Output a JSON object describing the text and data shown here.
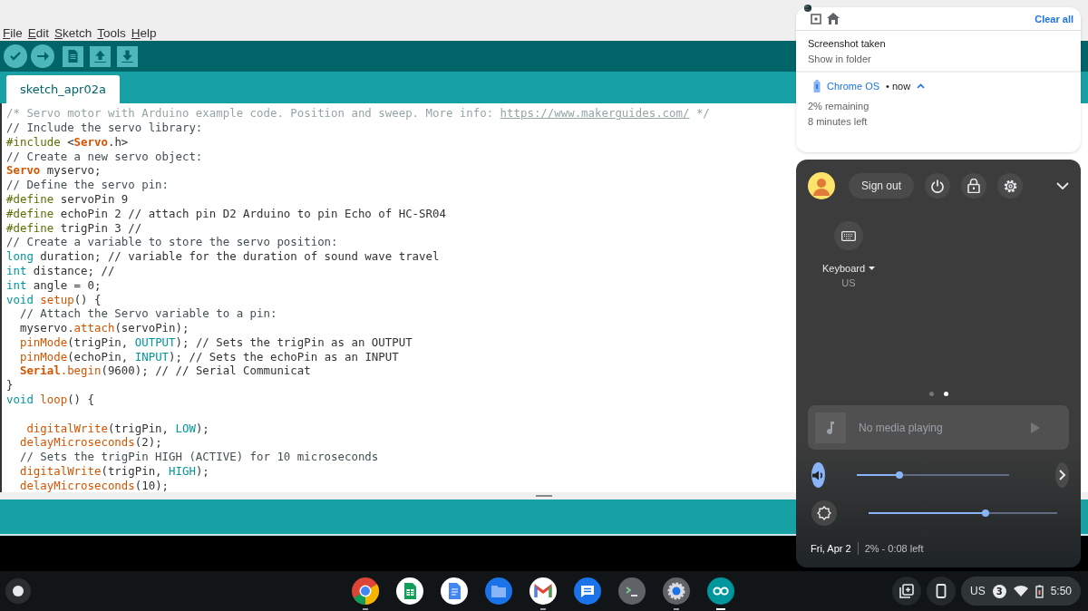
{
  "menu": [
    "File",
    "Edit",
    "Sketch",
    "Tools",
    "Help"
  ],
  "toolbar": [
    {
      "kind": "verify"
    },
    {
      "kind": "upload"
    },
    {
      "kind": "new"
    },
    {
      "kind": "open"
    },
    {
      "kind": "save"
    }
  ],
  "tabs": [
    {
      "label": "sketch_apr02a",
      "selected": true
    }
  ],
  "code": [
    {
      "kind": "code",
      "tokens": [
        {
          "text": "/* Servo motor with Arduino example code. Position and sweep. More info: ",
          "kind": "block"
        },
        {
          "text": "https://www.makerguides.com/",
          "kind": "link"
        },
        {
          "text": " */",
          "kind": "block"
        }
      ]
    },
    {
      "kind": "code",
      "tokens": [
        {
          "text": "// Include the servo library:",
          "kind": "comment"
        }
      ]
    },
    {
      "kind": "code",
      "tokens": [
        {
          "text": "#include",
          "kind": "pre"
        },
        {
          "text": " <",
          "kind": "plain"
        },
        {
          "text": "Servo",
          "kind": "class"
        },
        {
          "text": ".h>",
          "kind": "plain"
        }
      ]
    },
    {
      "kind": "code",
      "tokens": [
        {
          "text": "// Create a new servo object:",
          "kind": "comment"
        }
      ]
    },
    {
      "kind": "code",
      "tokens": [
        {
          "text": "Servo",
          "kind": "class"
        },
        {
          "text": " myservo;",
          "kind": "plain"
        }
      ]
    },
    {
      "kind": "code",
      "tokens": [
        {
          "text": "// Define the servo pin:",
          "kind": "comment"
        }
      ]
    },
    {
      "kind": "code",
      "tokens": [
        {
          "text": "#define",
          "kind": "pre"
        },
        {
          "text": " servoPin 9",
          "kind": "plain"
        }
      ]
    },
    {
      "kind": "code",
      "tokens": [
        {
          "text": "#define",
          "kind": "pre"
        },
        {
          "text": " echoPin 2 // attach pin D2 Arduino to pin Echo of HC-SR04",
          "kind": "plain"
        }
      ]
    },
    {
      "kind": "code",
      "tokens": [
        {
          "text": "#define",
          "kind": "pre"
        },
        {
          "text": " trigPin 3 //",
          "kind": "plain"
        }
      ]
    },
    {
      "kind": "code",
      "tokens": [
        {
          "text": "// Create a variable to store the servo position:",
          "kind": "comment"
        }
      ]
    },
    {
      "kind": "code",
      "tokens": [
        {
          "text": "long",
          "kind": "type"
        },
        {
          "text": " duration; // variable for the duration of sound wave travel",
          "kind": "plain"
        }
      ]
    },
    {
      "kind": "code",
      "tokens": [
        {
          "text": "int",
          "kind": "type"
        },
        {
          "text": " distance; //",
          "kind": "plain"
        }
      ]
    },
    {
      "kind": "code",
      "tokens": [
        {
          "text": "int",
          "kind": "type"
        },
        {
          "text": " angle = 0;",
          "kind": "plain"
        }
      ]
    },
    {
      "kind": "code",
      "tokens": [
        {
          "text": "void ",
          "kind": "type"
        },
        {
          "text": "setup",
          "kind": "func"
        },
        {
          "text": "() {",
          "kind": "plain"
        }
      ]
    },
    {
      "kind": "code",
      "tokens": [
        {
          "text": "  // Attach the Servo variable to a pin:",
          "kind": "comment"
        }
      ]
    },
    {
      "kind": "code",
      "tokens": [
        {
          "text": "  myservo.",
          "kind": "plain"
        },
        {
          "text": "attach",
          "kind": "func"
        },
        {
          "text": "(servoPin);",
          "kind": "plain"
        }
      ]
    },
    {
      "kind": "code",
      "tokens": [
        {
          "text": "  pinMode",
          "kind": "func"
        },
        {
          "text": "(trigPin, ",
          "kind": "plain"
        },
        {
          "text": "OUTPUT",
          "kind": "type"
        },
        {
          "text": "); // Sets the trigPin as an OUTPUT",
          "kind": "plain"
        }
      ]
    },
    {
      "kind": "code",
      "tokens": [
        {
          "text": "  pinMode",
          "kind": "func"
        },
        {
          "text": "(echoPin, ",
          "kind": "plain"
        },
        {
          "text": "INPUT",
          "kind": "type"
        },
        {
          "text": "); // Sets the echoPin as an INPUT",
          "kind": "plain"
        }
      ]
    },
    {
      "kind": "code",
      "tokens": [
        {
          "text": "  Serial",
          "kind": "class"
        },
        {
          "text": ".begin",
          "kind": "func"
        },
        {
          "text": "(9600); // // Serial Communicat",
          "kind": "plain"
        }
      ]
    },
    {
      "kind": "code",
      "tokens": [
        {
          "text": "}",
          "kind": "plain"
        }
      ]
    },
    {
      "kind": "code",
      "tokens": [
        {
          "text": "void ",
          "kind": "type"
        },
        {
          "text": "loop",
          "kind": "func"
        },
        {
          "text": "() {",
          "kind": "plain"
        }
      ]
    },
    {
      "kind": "blank"
    },
    {
      "kind": "code",
      "tokens": [
        {
          "text": "   digitalWrite",
          "kind": "func"
        },
        {
          "text": "(trigPin, ",
          "kind": "plain"
        },
        {
          "text": "LOW",
          "kind": "type"
        },
        {
          "text": ");",
          "kind": "plain"
        }
      ]
    },
    {
      "kind": "code",
      "tokens": [
        {
          "text": "  delayMicroseconds",
          "kind": "func"
        },
        {
          "text": "(2);",
          "kind": "plain"
        }
      ]
    },
    {
      "kind": "code",
      "tokens": [
        {
          "text": "  // Sets the trigPin HIGH (ACTIVE) for 10 microseconds",
          "kind": "comment"
        }
      ]
    },
    {
      "kind": "code",
      "tokens": [
        {
          "text": "  digitalWrite",
          "kind": "func"
        },
        {
          "text": "(trigPin, ",
          "kind": "plain"
        },
        {
          "text": "HIGH",
          "kind": "type"
        },
        {
          "text": ");",
          "kind": "plain"
        }
      ]
    },
    {
      "kind": "code",
      "tokens": [
        {
          "text": "  delayMicroseconds",
          "kind": "func"
        },
        {
          "text": "(10);",
          "kind": "plain"
        }
      ]
    }
  ],
  "notifications": {
    "clear_all": "Clear all",
    "screenshot": {
      "title": "Screenshot taken",
      "action": "Show in folder"
    },
    "battery": {
      "app": "Chrome OS",
      "time": "• now",
      "expanded": true,
      "lines": [
        "2% remaining",
        "8 minutes left"
      ]
    }
  },
  "quick_settings": {
    "sign_out": "Sign out",
    "keyboard": {
      "label": "Keyboard",
      "layout": "US"
    },
    "pages": [
      {
        "selected": false
      },
      {
        "selected": true
      }
    ],
    "media": "No media playing",
    "volume": {
      "level": 0.28,
      "active": true
    },
    "brightness": {
      "level": 0.62
    },
    "date": "Fri, Apr 2",
    "battery": "2% - 0:08 left"
  },
  "shelf": {
    "apps": [
      {
        "kind": "chrome",
        "running": true
      },
      {
        "kind": "sheets",
        "running": false
      },
      {
        "kind": "docs",
        "running": false
      },
      {
        "kind": "files",
        "running": false
      },
      {
        "kind": "gmail",
        "running": true
      },
      {
        "kind": "messages",
        "running": false
      },
      {
        "kind": "terminal",
        "running": false
      },
      {
        "kind": "settings",
        "running": true
      },
      {
        "kind": "arduino",
        "running": true,
        "active": true
      }
    ],
    "ime": "US",
    "notification_count": "3",
    "time": "5:50"
  }
}
